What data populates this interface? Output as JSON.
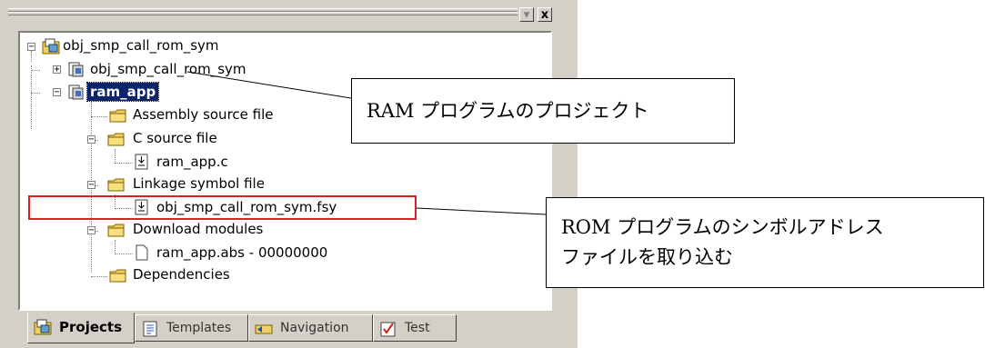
{
  "panel": {
    "title_buttons": {
      "restore": "▾",
      "close": "x"
    }
  },
  "tree": {
    "root": {
      "label": "obj_smp_call_rom_sym",
      "expander": "−"
    },
    "project1": {
      "label": "obj_smp_call_rom_sym",
      "expander": "+"
    },
    "project2": {
      "label": "ram_app",
      "expander": "−"
    },
    "assembly_folder": {
      "label": "Assembly source file"
    },
    "c_folder": {
      "label": "C source file",
      "expander": "−"
    },
    "c_file": {
      "label": "ram_app.c"
    },
    "linkage_folder": {
      "label": "Linkage symbol file",
      "expander": "−"
    },
    "linkage_file": {
      "label": "obj_smp_call_rom_sym.fsy"
    },
    "download_folder": {
      "label": "Download modules",
      "expander": "−"
    },
    "download_file": {
      "label": "ram_app.abs - 00000000"
    },
    "dependencies_folder": {
      "label": "Dependencies"
    }
  },
  "tabs": [
    {
      "label": "Projects",
      "icon": "projects-icon",
      "active": true
    },
    {
      "label": "Templates",
      "icon": "templates-icon",
      "active": false
    },
    {
      "label": "Navigation",
      "icon": "navigation-icon",
      "active": false
    },
    {
      "label": "Test",
      "icon": "test-icon",
      "active": false
    }
  ],
  "callouts": {
    "ram_project": "RAM プログラムのプロジェクト",
    "rom_symbol_line1": "ROM プログラムのシンボルアドレス",
    "rom_symbol_line2": "ファイルを取り込む"
  },
  "colors": {
    "panel_bg": "#d4d0c8",
    "selection_bg": "#0a246a",
    "highlight_border": "#e02020",
    "folder_yellow": "#f0d060"
  }
}
